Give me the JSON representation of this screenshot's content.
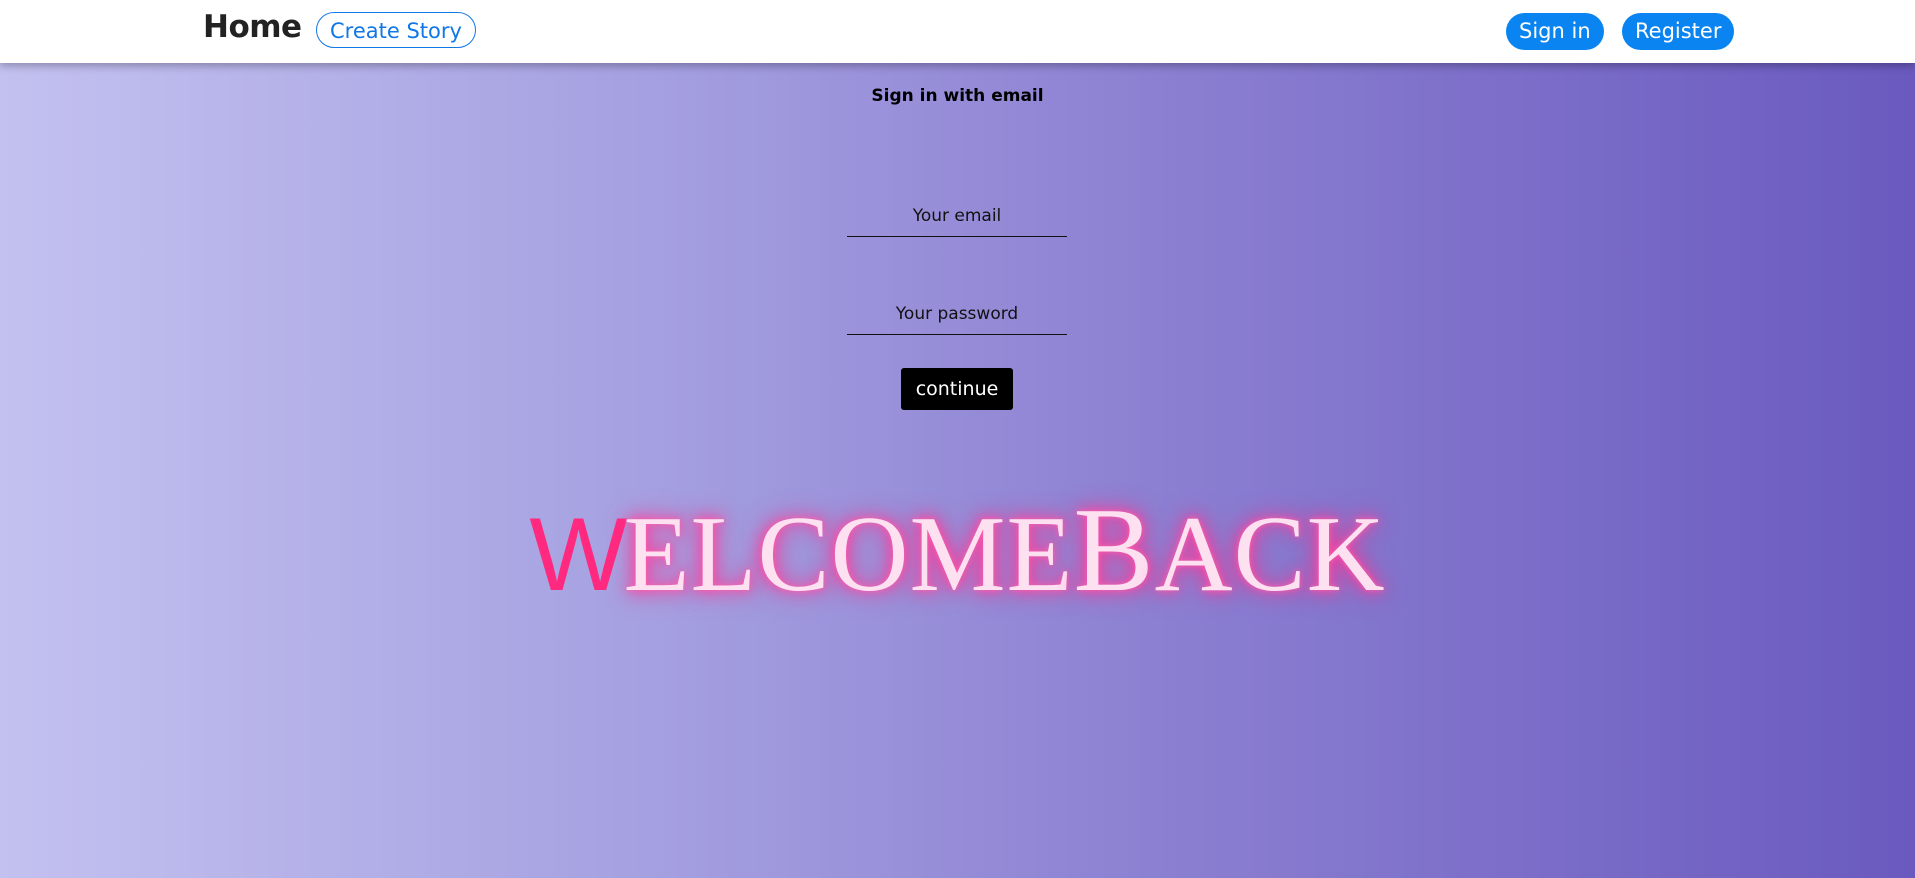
{
  "navbar": {
    "brand": "Home",
    "create_story": "Create Story",
    "sign_in": "Sign in",
    "register": "Register"
  },
  "form": {
    "title": "Sign in with email",
    "email_placeholder": "Your email",
    "password_placeholder": "Your password",
    "continue_label": "continue"
  },
  "welcome": {
    "first_letter": "W",
    "rest_1": "ELCOME",
    "big_letter": "B",
    "rest_2": "ACK"
  },
  "colors": {
    "primary_blue": "#0a84f0",
    "accent_pink": "#ff2a7f",
    "glow_pink": "#ff3d9d",
    "background_start": "#c3c1f0",
    "background_end": "#6a5abf"
  }
}
